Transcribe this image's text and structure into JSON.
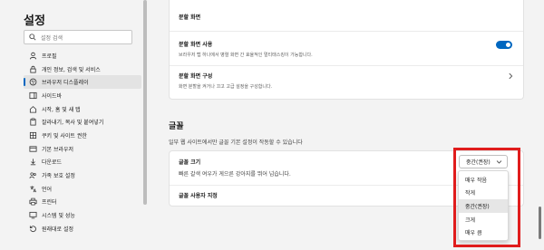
{
  "sidebar": {
    "title": "설정",
    "search_placeholder": "설정 검색",
    "items": [
      {
        "label": "프로필",
        "icon": "profile-icon"
      },
      {
        "label": "개인 정보, 검색 및 서비스",
        "icon": "lock-icon"
      },
      {
        "label": "브라우저 디스플레이",
        "icon": "appearance-icon",
        "active": true
      },
      {
        "label": "사이드바",
        "icon": "sidebar-icon"
      },
      {
        "label": "시작, 홈 및 새 탭",
        "icon": "home-icon"
      },
      {
        "label": "잘라내기, 복사 및 붙여넣기",
        "icon": "clipboard-icon"
      },
      {
        "label": "쿠키 및 사이트 권한",
        "icon": "cookie-icon"
      },
      {
        "label": "기본 브라우저",
        "icon": "browser-icon"
      },
      {
        "label": "다운로드",
        "icon": "download-icon"
      },
      {
        "label": "가족 보호 설정",
        "icon": "family-icon"
      },
      {
        "label": "언어",
        "icon": "language-icon"
      },
      {
        "label": "프린터",
        "icon": "printer-icon"
      },
      {
        "label": "시스템 및 성능",
        "icon": "system-icon"
      },
      {
        "label": "원래대로 설정",
        "icon": "reset-icon"
      }
    ]
  },
  "split_card": {
    "header": "분할 화면",
    "use_title": "분할 화면 사용",
    "use_desc": "브라우저 탭 하나에서 병렬 화면 간 효율적인 멀티태스킹이 가능합니다.",
    "toggle_on": true,
    "config_title": "분할 화면 구성",
    "config_desc": "화면 분할을 켜거나 끄고 고급 설정을 구성합니다."
  },
  "font_section": {
    "title": "글꼴",
    "subtitle": "일부 웹 사이트에서만 글꼴 기본 설정이 작동할 수 있습니다",
    "size_title": "글꼴 크기",
    "size_desc": "빠른 갈색 여우가 게으른 강아지를 뛰어 넘습니다.",
    "custom_title": "글꼴 사용자 지정",
    "selected": "중간(권장)",
    "options": [
      "매우 작음",
      "작게",
      "중간(권장)",
      "크게",
      "매우 큼"
    ],
    "highlight_color": "#e01c1c",
    "accent_color": "#0067c0"
  }
}
